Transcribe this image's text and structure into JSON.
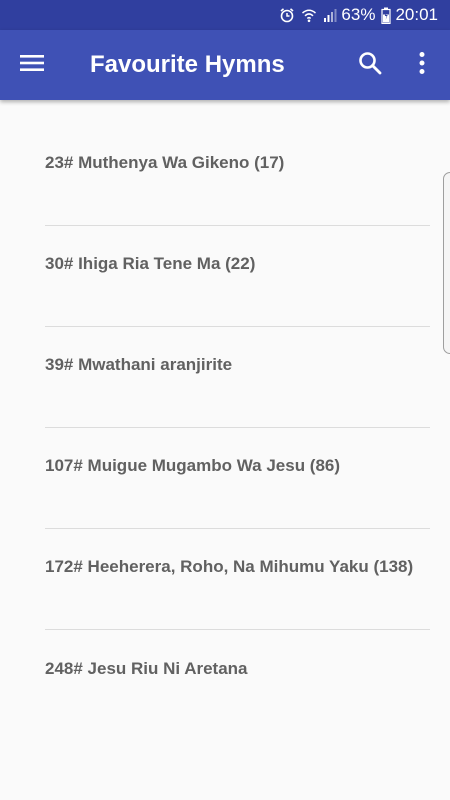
{
  "status_bar": {
    "battery": "63%",
    "time": "20:01",
    "icons": [
      "alarm-icon",
      "wifi-icon",
      "signal-icon",
      "battery-icon"
    ]
  },
  "app_bar": {
    "title": "Favourite Hymns",
    "background": "#3f51b5",
    "status_background": "#303f9f",
    "icons": [
      "menu-icon",
      "search-icon",
      "more-vert-icon"
    ]
  },
  "hymns": [
    {
      "label": "23# Muthenya Wa Gikeno (17)"
    },
    {
      "label": "30# Ihiga Ria Tene Ma (22)"
    },
    {
      "label": "39# Mwathani aranjirite"
    },
    {
      "label": "107# Muigue Mugambo Wa Jesu (86)"
    },
    {
      "label": "172# Heeherera, Roho, Na Mihumu Yaku (138)"
    },
    {
      "label": "248# Jesu Riu Ni Aretana"
    }
  ]
}
